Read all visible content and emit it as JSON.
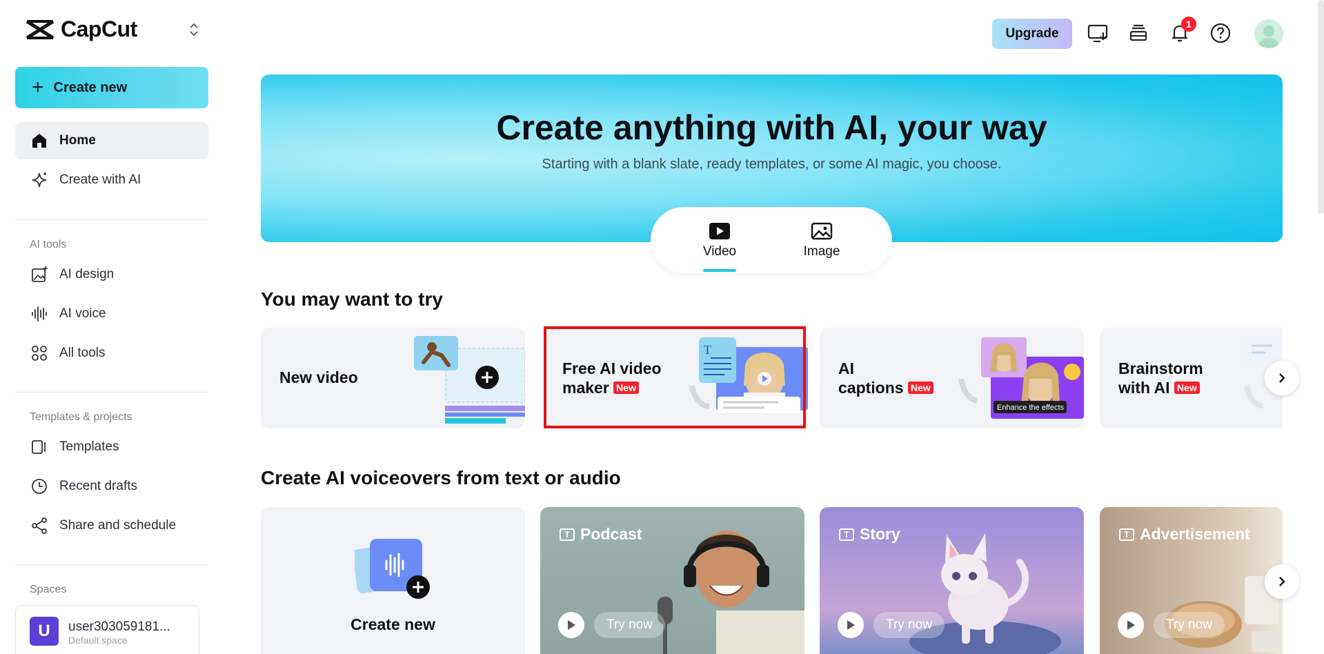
{
  "brand": {
    "name": "CapCut"
  },
  "sidebar": {
    "create_new": "Create new",
    "primary": [
      {
        "label": "Home",
        "icon": "home-icon",
        "active": true
      },
      {
        "label": "Create with AI",
        "icon": "sparkle-icon",
        "active": false
      }
    ],
    "ai_tools_label": "AI tools",
    "ai_tools": [
      {
        "label": "AI design",
        "icon": "image-sparkle-icon"
      },
      {
        "label": "AI voice",
        "icon": "waveform-icon"
      },
      {
        "label": "All tools",
        "icon": "grid-icon"
      }
    ],
    "templates_label": "Templates & projects",
    "templates": [
      {
        "label": "Templates",
        "icon": "template-icon"
      },
      {
        "label": "Recent drafts",
        "icon": "clock-icon"
      },
      {
        "label": "Share and schedule",
        "icon": "share-icon"
      }
    ],
    "spaces_label": "Spaces",
    "space": {
      "initial": "U",
      "name": "user303059181...",
      "sub": "Default space"
    }
  },
  "topbar": {
    "upgrade": "Upgrade",
    "notification_count": "1"
  },
  "hero": {
    "title": "Create anything with AI, your way",
    "subtitle": "Starting with a blank slate, ready templates, or some AI magic, you choose.",
    "tabs": [
      {
        "label": "Video",
        "active": true
      },
      {
        "label": "Image",
        "active": false
      }
    ]
  },
  "try_section": {
    "title": "You may want to try",
    "cards": [
      {
        "line1": "New video",
        "line2": "",
        "new": false
      },
      {
        "line1": "Free AI video",
        "line2": "maker",
        "new": true
      },
      {
        "line1": "AI",
        "line2": "captions",
        "new": true
      },
      {
        "line1": "Brainstorm",
        "line2": "with AI",
        "new": true
      }
    ],
    "new_tag": "New",
    "captions_overlay": "Enhance the effects"
  },
  "voice_section": {
    "title": "Create AI voiceovers from text or audio",
    "create_new": "Create new",
    "cards": [
      {
        "label": "Podcast",
        "cta": "Try now"
      },
      {
        "label": "Story",
        "cta": "Try now"
      },
      {
        "label": "Advertisement",
        "cta": "Try now"
      }
    ]
  }
}
